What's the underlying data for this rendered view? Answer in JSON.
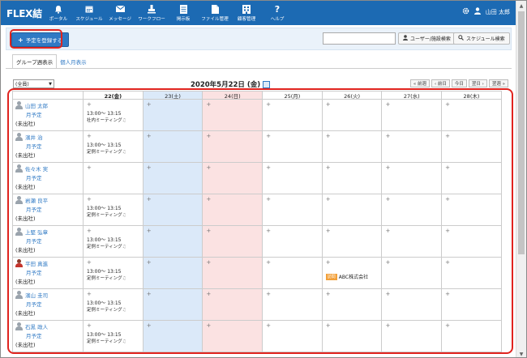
{
  "app": {
    "logo": "FLEX結"
  },
  "nav": [
    {
      "label": "ポータル",
      "icon": "bell-icon"
    },
    {
      "label": "スケジュール",
      "icon": "calendar-icon"
    },
    {
      "label": "メッセージ",
      "icon": "envelope-icon"
    },
    {
      "label": "ワークフロー",
      "icon": "stamp-icon"
    },
    {
      "label": "掲示板",
      "icon": "board-icon"
    },
    {
      "label": "ファイル管理",
      "icon": "file-icon"
    },
    {
      "label": "顧客管理",
      "icon": "customer-icon"
    },
    {
      "label": "ヘルプ",
      "icon": "help-icon"
    }
  ],
  "user": {
    "name": "山田 太郎"
  },
  "toolbar": {
    "register_label": "予定を登録する",
    "search_placeholder": "",
    "user_search_label": "ユーザー/施設検索",
    "schedule_search_label": "スケジュール検索"
  },
  "tabs": [
    {
      "label": "グループ週表示",
      "active": true
    },
    {
      "label": "個人月表示",
      "active": false
    }
  ],
  "controls": {
    "group_select": "(全員)",
    "date_title": "2020年5月22日 (金)",
    "pager": [
      "« 前週",
      "‹ 前日",
      "今日",
      "翌日 ›",
      "翌週 »"
    ]
  },
  "grid": {
    "days": [
      {
        "label": "22(金)",
        "kind": "today"
      },
      {
        "label": "23(土)",
        "kind": "sat"
      },
      {
        "label": "24(日)",
        "kind": "sun"
      },
      {
        "label": "25(月)",
        "kind": "weekday"
      },
      {
        "label": "26(火)",
        "kind": "weekday"
      },
      {
        "label": "27(水)",
        "kind": "weekday"
      },
      {
        "label": "28(木)",
        "kind": "weekday"
      }
    ],
    "month_link": "月予定",
    "users": [
      {
        "name": "山田 太郎",
        "status": "(未出社)",
        "photo": false,
        "event": {
          "time": "13:00～ 13:15",
          "title": "社内ミーティング"
        }
      },
      {
        "name": "濱井 治",
        "status": "(未出社)",
        "photo": false,
        "event": {
          "time": "13:00～ 13:15",
          "title": "定例ミーティング"
        }
      },
      {
        "name": "佐々木 実",
        "status": "(未出社)",
        "photo": false,
        "event": null
      },
      {
        "name": "岩瀬 良平",
        "status": "(未出社)",
        "photo": false,
        "event": {
          "time": "13:00～ 13:15",
          "title": "定例ミーティング"
        }
      },
      {
        "name": "上堅 弘章",
        "status": "(未出社)",
        "photo": false,
        "event": {
          "time": "13:00～ 13:15",
          "title": "定例ミーティング"
        }
      },
      {
        "name": "平田 真進",
        "status": "(未出社)",
        "photo": true,
        "event": {
          "time": "13:00～ 13:15",
          "title": "定例ミーティング"
        },
        "tue_event": {
          "tag": "訪問",
          "title": "ABC株式会社"
        }
      },
      {
        "name": "濱山 圭司",
        "status": "(未出社)",
        "photo": false,
        "event": {
          "time": "13:00～ 13:15",
          "title": "定例ミーティング"
        }
      },
      {
        "name": "石黒 政人",
        "status": "(未出社)",
        "photo": false,
        "event": {
          "time": "13:00～ 13:15",
          "title": "定例ミーティング"
        }
      }
    ]
  },
  "colors": {
    "brand": "#1c6ab3",
    "button": "#2f79c4",
    "highlight": "#e0241f",
    "saturday": "#dbe9f9",
    "sunday": "#fbe2e2"
  }
}
